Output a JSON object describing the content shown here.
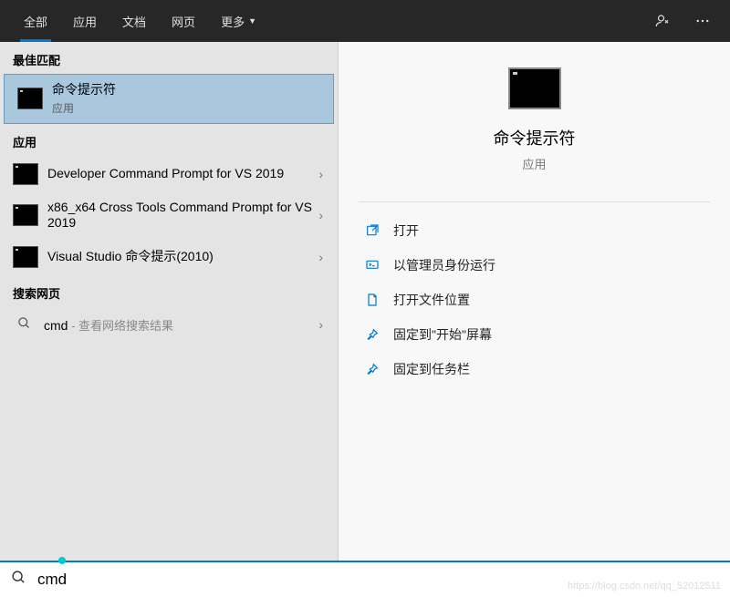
{
  "tabs": {
    "all": "全部",
    "apps": "应用",
    "docs": "文档",
    "web": "网页",
    "more": "更多"
  },
  "sections": {
    "best_match": "最佳匹配",
    "apps": "应用",
    "search_web": "搜索网页"
  },
  "best_match": {
    "title": "命令提示符",
    "subtitle": "应用"
  },
  "app_results": [
    {
      "title": "Developer Command Prompt for VS 2019"
    },
    {
      "title": "x86_x64 Cross Tools Command Prompt for VS 2019"
    },
    {
      "title": "Visual Studio 命令提示(2010)"
    }
  ],
  "web_result": {
    "query": "cmd",
    "suffix": " - 查看网络搜索结果"
  },
  "detail": {
    "title": "命令提示符",
    "subtitle": "应用"
  },
  "actions": {
    "open": "打开",
    "admin": "以管理员身份运行",
    "location": "打开文件位置",
    "pin_start": "固定到\"开始\"屏幕",
    "pin_taskbar": "固定到任务栏"
  },
  "search": {
    "value": "cmd"
  },
  "watermark": "https://blog.csdn.net/qq_52012511"
}
